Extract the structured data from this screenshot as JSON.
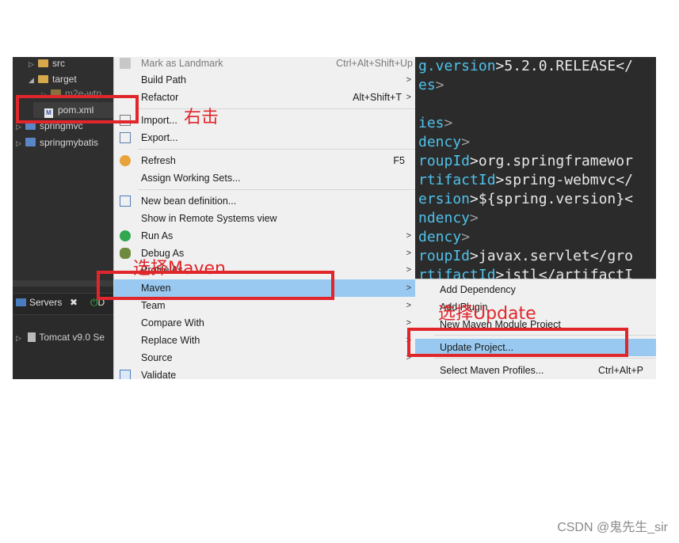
{
  "explorer": {
    "tree": [
      {
        "label": "src",
        "arrow": "▷",
        "icon": "folder-icon"
      },
      {
        "label": "target",
        "arrow": "◢",
        "icon": "folder-icon"
      },
      {
        "label": "m2e-wtp",
        "arrow": "▷",
        "icon": "folder-icon"
      },
      {
        "label": "pom.xml",
        "arrow": "",
        "icon": "xml-file-icon"
      },
      {
        "label": "springmvc",
        "arrow": "▷",
        "icon": "project-icon"
      },
      {
        "label": "springmybatis",
        "arrow": "▷",
        "icon": "project-icon"
      }
    ]
  },
  "servers": {
    "tab_label": "Servers",
    "close_glyph": "✖",
    "second_tab_initial": "D",
    "server_row": "Tomcat v9.0 Se"
  },
  "context_menu": {
    "items": [
      {
        "label": "Mark as Landmark",
        "accel": "Ctrl+Alt+Shift+Up",
        "dim": true
      },
      {
        "label": "Build Path",
        "submenu": true
      },
      {
        "label": "Refactor",
        "accel": "Alt+Shift+T",
        "submenu": true
      },
      {
        "label": "Import..."
      },
      {
        "label": "Export..."
      },
      {
        "label": "Refresh",
        "accel": "F5"
      },
      {
        "label": "Assign Working Sets..."
      },
      {
        "label": "New bean definition..."
      },
      {
        "label": "Show in Remote Systems view"
      },
      {
        "label": "Run As",
        "submenu": true
      },
      {
        "label": "Debug As",
        "submenu": true
      },
      {
        "label": "Profile As",
        "submenu": true
      },
      {
        "label": "Maven",
        "submenu": true,
        "highlighted": true
      },
      {
        "label": "Team",
        "submenu": true
      },
      {
        "label": "Compare With",
        "submenu": true
      },
      {
        "label": "Replace With",
        "submenu": true
      },
      {
        "label": "Source",
        "submenu": true
      },
      {
        "label": "Validate"
      }
    ],
    "submenu_glyph": ">"
  },
  "editor": {
    "lines": [
      {
        "tag": "g.version",
        "rest": ">5.2.0.RELEASE</"
      },
      {
        "tag": "es",
        "rest": ">"
      },
      {
        "tag": "",
        "rest": ""
      },
      {
        "tag": "ies",
        "rest": ">"
      },
      {
        "tag": "dency",
        "rest": ">"
      },
      {
        "tag": "roupId",
        "rest": ">org.springframewor"
      },
      {
        "tag": "rtifactId",
        "rest": ">spring-webmvc</"
      },
      {
        "tag": "ersion",
        "rest": ">${spring.version}<"
      },
      {
        "tag": "ndency",
        "rest": ">"
      },
      {
        "tag": "dency",
        "rest": ">"
      },
      {
        "tag": "roupId",
        "rest": ">javax.servlet</gro"
      },
      {
        "tag": "rtifactId",
        "rest": ">jstl</artifactI"
      }
    ]
  },
  "maven_submenu": {
    "items": [
      {
        "label": "Add Dependency"
      },
      {
        "label": "Add Plugin"
      },
      {
        "label": "New Maven Module Project"
      },
      {
        "label": "Update Project...",
        "highlighted": true
      },
      {
        "label": "Select Maven Profiles...",
        "accel": "Ctrl+Alt+P"
      }
    ]
  },
  "annotations": {
    "right_click": "右击",
    "choose_maven": "选择Maven",
    "choose_update": "选择Update"
  },
  "watermark": "CSDN @鬼先生_sir",
  "colors": {
    "annotation_red": "#e0262b",
    "menu_highlight": "#99c9f0",
    "xml_tag": "#4fc1e9"
  }
}
